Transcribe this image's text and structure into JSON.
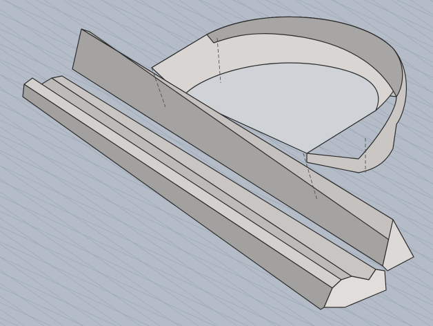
{
  "scene": {
    "background": "#b3bcc7",
    "grid_color": "#9ea9b6",
    "part_light": "#d9d6d3",
    "part_mid": "#bfbcba",
    "part_dark": "#9c9a99",
    "edge_color": "#2b2b2b"
  }
}
